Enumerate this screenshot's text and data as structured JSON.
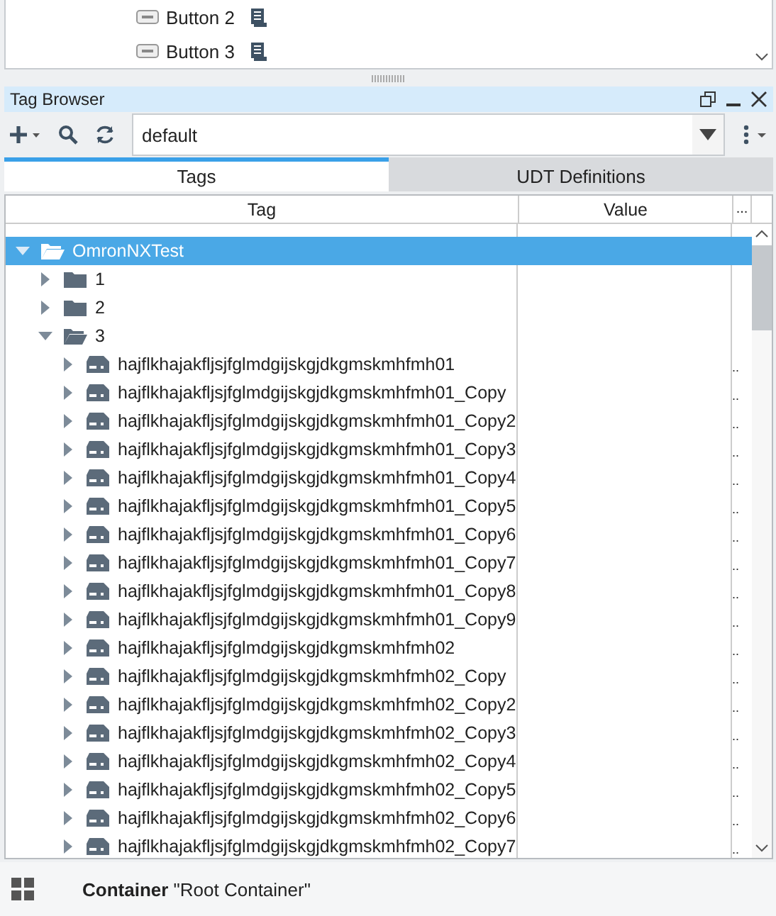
{
  "component_tree": {
    "items": [
      {
        "label": "Button 2"
      },
      {
        "label": "Button 3"
      }
    ]
  },
  "tag_browser": {
    "title": "Tag Browser",
    "provider": {
      "value": "default"
    },
    "tabs": [
      {
        "label": "Tags",
        "selected": true
      },
      {
        "label": "UDT Definitions",
        "selected": false
      }
    ],
    "table": {
      "columns": [
        "Tag",
        "Value",
        "..."
      ],
      "tree": [
        {
          "kind": "folder",
          "label": "OmronNXTest",
          "expanded": true,
          "selected": true,
          "children": [
            {
              "kind": "folder",
              "label": "1",
              "expanded": false,
              "selected": false
            },
            {
              "kind": "folder",
              "label": "2",
              "expanded": false,
              "selected": false
            },
            {
              "kind": "folder",
              "label": "3",
              "expanded": true,
              "selected": false,
              "children": [
                {
                  "kind": "tag",
                  "label": "hajflkhajakfljsjfglmdgijskgjdkgmskmhfmh01",
                  "column_3": "..",
                  "selected": false
                },
                {
                  "kind": "tag",
                  "label": "hajflkhajakfljsjfglmdgijskgjdkgmskmhfmh01_Copy",
                  "column_3": "..",
                  "selected": false
                },
                {
                  "kind": "tag",
                  "label": "hajflkhajakfljsjfglmdgijskgjdkgmskmhfmh01_Copy2",
                  "column_3": "..",
                  "selected": false
                },
                {
                  "kind": "tag",
                  "label": "hajflkhajakfljsjfglmdgijskgjdkgmskmhfmh01_Copy3",
                  "column_3": "..",
                  "selected": false
                },
                {
                  "kind": "tag",
                  "label": "hajflkhajakfljsjfglmdgijskgjdkgmskmhfmh01_Copy4",
                  "column_3": "..",
                  "selected": false
                },
                {
                  "kind": "tag",
                  "label": "hajflkhajakfljsjfglmdgijskgjdkgmskmhfmh01_Copy5",
                  "column_3": "..",
                  "selected": false
                },
                {
                  "kind": "tag",
                  "label": "hajflkhajakfljsjfglmdgijskgjdkgmskmhfmh01_Copy6",
                  "column_3": "..",
                  "selected": false
                },
                {
                  "kind": "tag",
                  "label": "hajflkhajakfljsjfglmdgijskgjdkgmskmhfmh01_Copy7",
                  "column_3": "..",
                  "selected": false
                },
                {
                  "kind": "tag",
                  "label": "hajflkhajakfljsjfglmdgijskgjdkgmskmhfmh01_Copy8",
                  "column_3": "..",
                  "selected": false
                },
                {
                  "kind": "tag",
                  "label": "hajflkhajakfljsjfglmdgijskgjdkgmskmhfmh01_Copy9",
                  "column_3": "..",
                  "selected": false
                },
                {
                  "kind": "tag",
                  "label": "hajflkhajakfljsjfglmdgijskgjdkgmskmhfmh02",
                  "column_3": "..",
                  "selected": false
                },
                {
                  "kind": "tag",
                  "label": "hajflkhajakfljsjfglmdgijskgjdkgmskmhfmh02_Copy",
                  "column_3": "..",
                  "selected": false
                },
                {
                  "kind": "tag",
                  "label": "hajflkhajakfljsjfglmdgijskgjdkgmskmhfmh02_Copy2",
                  "column_3": "..",
                  "selected": false
                },
                {
                  "kind": "tag",
                  "label": "hajflkhajakfljsjfglmdgijskgjdkgmskmhfmh02_Copy3",
                  "column_3": "..",
                  "selected": false
                },
                {
                  "kind": "tag",
                  "label": "hajflkhajakfljsjfglmdgijskgjdkgmskmhfmh02_Copy4",
                  "column_3": "..",
                  "selected": false
                },
                {
                  "kind": "tag",
                  "label": "hajflkhajakfljsjfglmdgijskgjdkgmskmhfmh02_Copy5",
                  "column_3": "..",
                  "selected": false
                },
                {
                  "kind": "tag",
                  "label": "hajflkhajakfljsjfglmdgijskgjdkgmskmhfmh02_Copy6",
                  "column_3": "..",
                  "selected": false
                },
                {
                  "kind": "tag",
                  "label": "hajflkhajakfljsjfglmdgijskgjdkgmskmhfmh02_Copy7",
                  "column_3": "..",
                  "selected": false
                }
              ]
            }
          ]
        }
      ]
    }
  },
  "status_bar": {
    "text": "**Container** \"Root Container\""
  }
}
